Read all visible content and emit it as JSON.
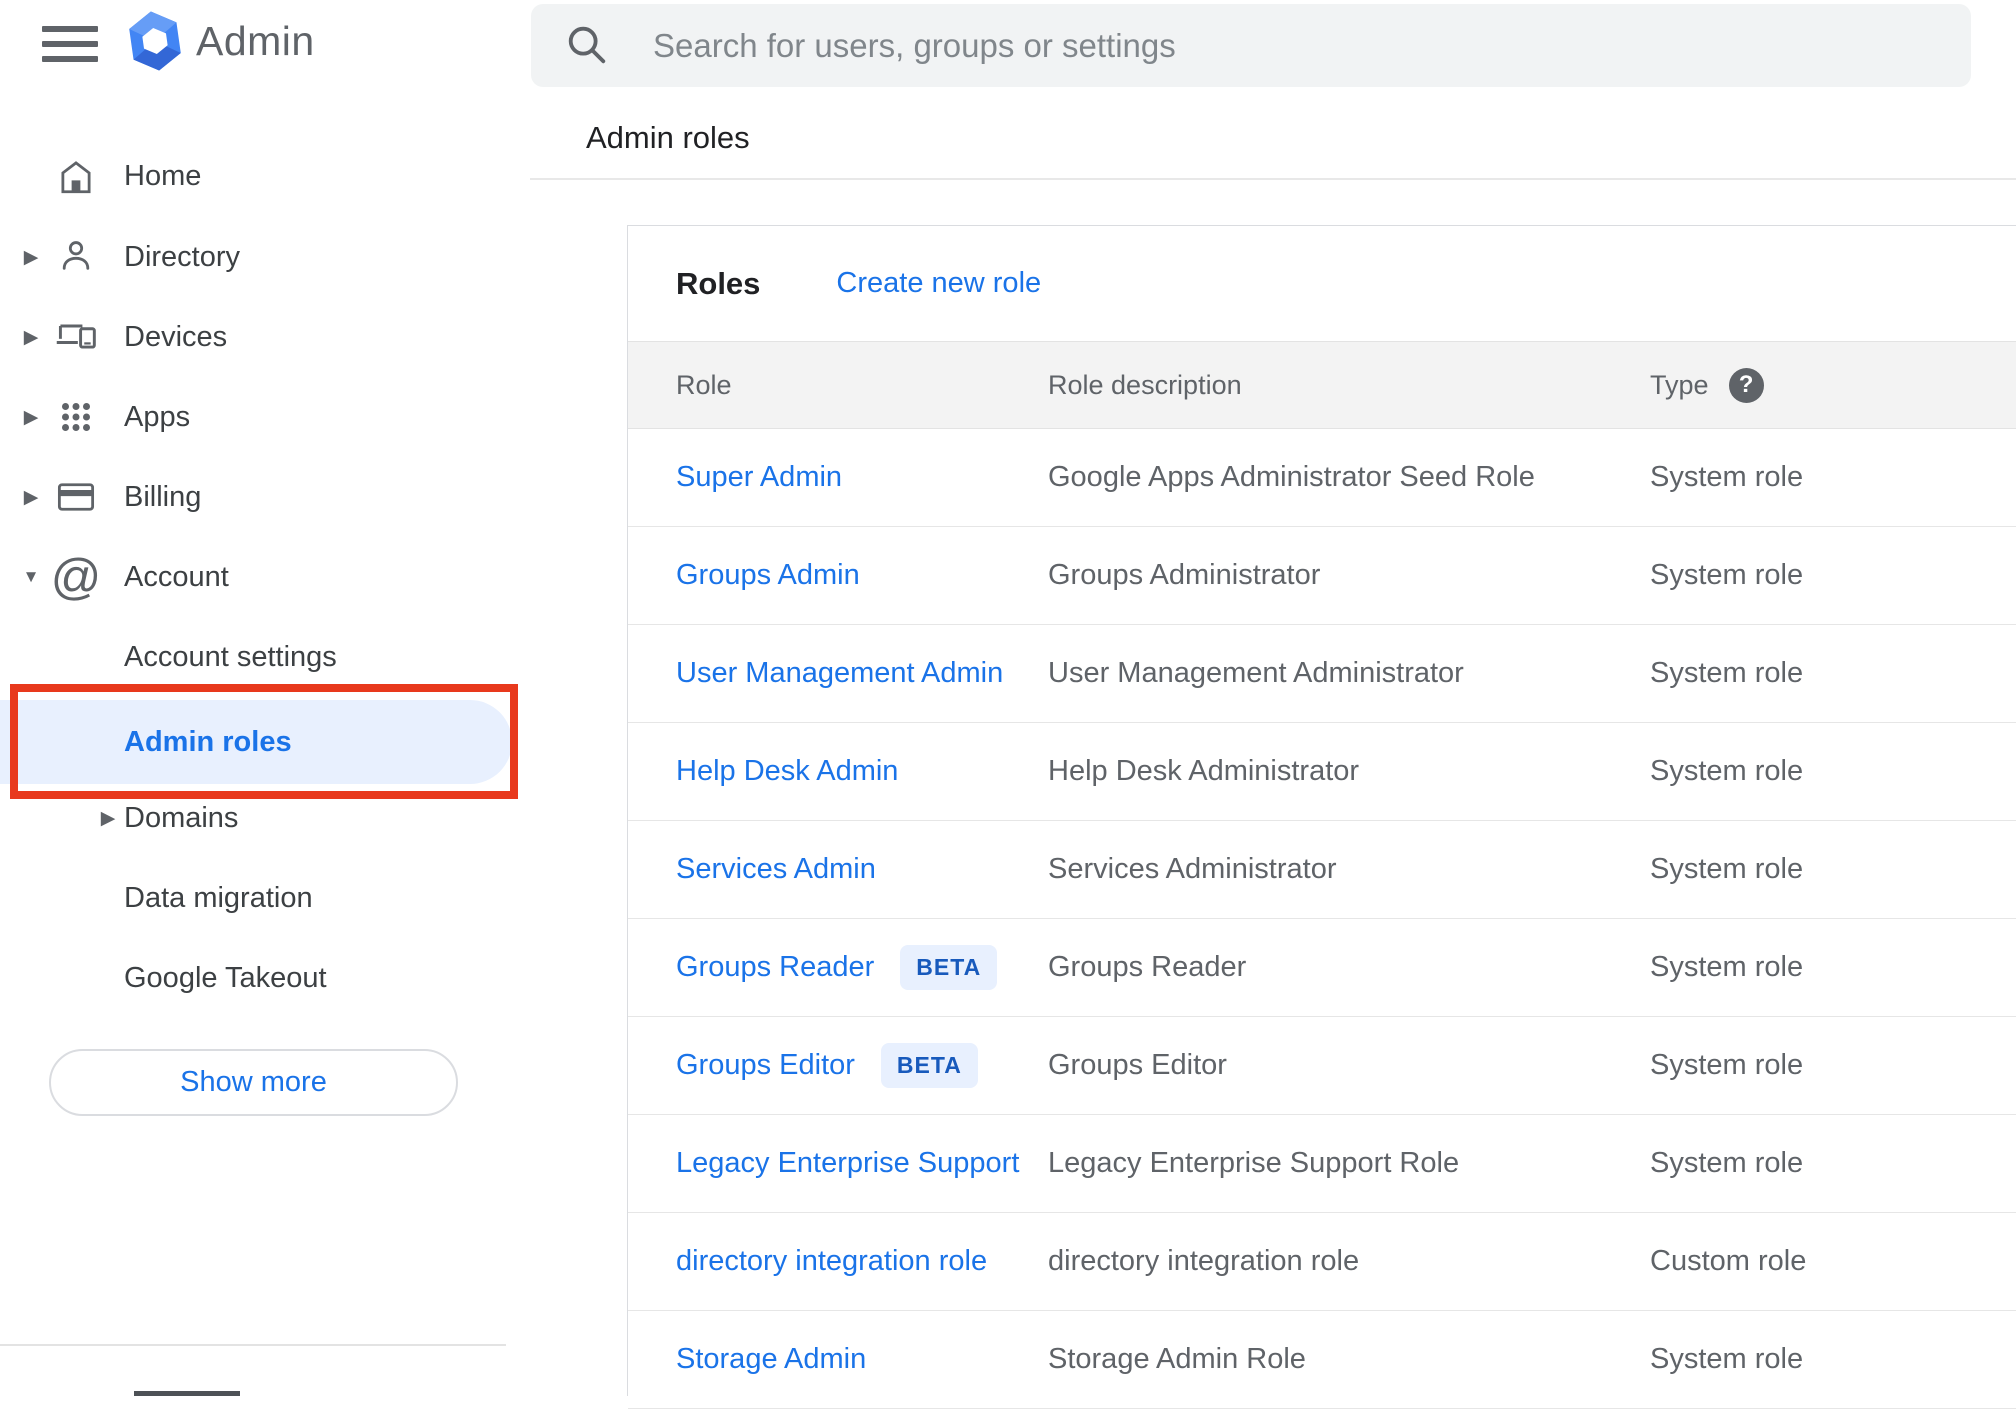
{
  "brand": {
    "name": "Admin"
  },
  "icons": {
    "expand_right": "▶",
    "expand_down": "▼",
    "help_glyph": "?"
  },
  "search": {
    "placeholder": "Search for users, groups or settings"
  },
  "page": {
    "title": "Admin roles"
  },
  "sidebar": {
    "items": [
      {
        "label": "Home"
      },
      {
        "label": "Directory"
      },
      {
        "label": "Devices"
      },
      {
        "label": "Apps"
      },
      {
        "label": "Billing"
      },
      {
        "label": "Account"
      }
    ],
    "account_children": [
      {
        "label": "Account settings"
      },
      {
        "label": "Admin roles",
        "active": true
      },
      {
        "label": "Domains"
      },
      {
        "label": "Data migration"
      },
      {
        "label": "Google Takeout"
      }
    ],
    "show_more_label": "Show more"
  },
  "roles_panel": {
    "title": "Roles",
    "create_link_label": "Create new role",
    "columns": {
      "role": "Role",
      "description": "Role description",
      "type": "Type"
    },
    "beta_label": "BETA",
    "rows": [
      {
        "role": "Super Admin",
        "description": "Google Apps Administrator Seed Role",
        "type": "System role"
      },
      {
        "role": "Groups Admin",
        "description": "Groups Administrator",
        "type": "System role"
      },
      {
        "role": "User Management Admin",
        "description": "User Management Administrator",
        "type": "System role"
      },
      {
        "role": "Help Desk Admin",
        "description": "Help Desk Administrator",
        "type": "System role"
      },
      {
        "role": "Services Admin",
        "description": "Services Administrator",
        "type": "System role"
      },
      {
        "role": "Groups Reader",
        "beta": true,
        "description": "Groups Reader",
        "type": "System role"
      },
      {
        "role": "Groups Editor",
        "beta": true,
        "description": "Groups Editor",
        "type": "System role"
      },
      {
        "role": "Legacy Enterprise Support",
        "description": "Legacy Enterprise Support Role",
        "type": "System role"
      },
      {
        "role": "directory integration role",
        "description": "directory integration role",
        "type": "Custom role"
      },
      {
        "role": "Storage Admin",
        "description": "Storage Admin Role",
        "type": "System role"
      }
    ]
  },
  "annotation": {
    "box_style": "border-color:#e8391d",
    "annotation_red": "#e8391d"
  },
  "colors": {
    "link_blue": "#1a73e8",
    "active_item_bg": "#e8f0fe",
    "beta_bg": "#e8f0fe",
    "beta_text": "#185abc",
    "text_primary": "#202124",
    "text_secondary": "#5f6368",
    "search_bg": "#f1f3f4",
    "divider": "#e0e0e0",
    "thead_bg": "#f3f3f3",
    "logo_blue": "#4285f4"
  }
}
